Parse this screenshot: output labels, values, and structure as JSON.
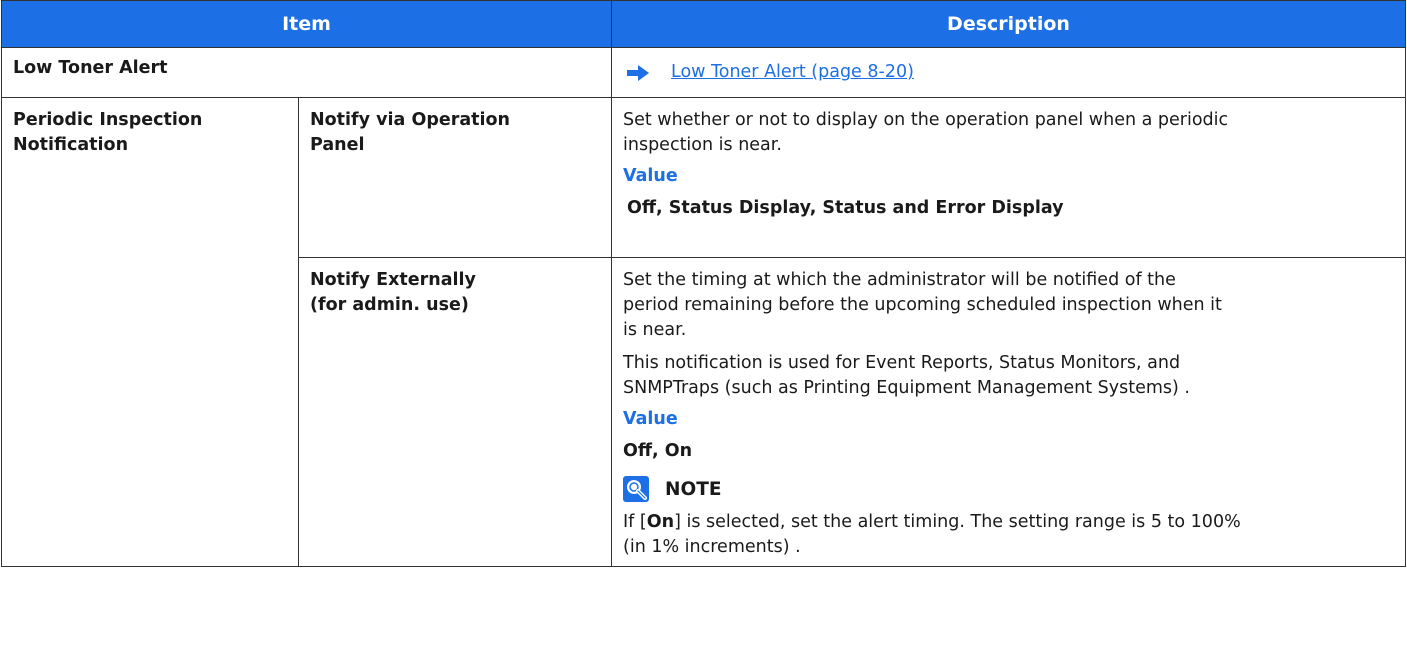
{
  "table": {
    "header": {
      "item": "Item",
      "description": "Description"
    },
    "low_toner": {
      "label": "Low Toner Alert",
      "link_text": "Low Toner Alert (page 8-20)"
    },
    "periodic": {
      "label_line1": "Periodic Inspection",
      "label_line2": "Notification",
      "panel": {
        "label_line1": "Notify via Operation",
        "label_line2": "Panel",
        "desc_line1": "Set whether or not to display on the operation panel when a periodic",
        "desc_line2": "inspection is near.",
        "value_label": "Value",
        "value_text": "Off, Status Display, Status and Error Display"
      },
      "external": {
        "label_line1": "Notify Externally",
        "label_line2": "(for admin. use)",
        "desc1_line1": "Set the timing at which the administrator will be notified of the",
        "desc1_line2": "period remaining before the upcoming scheduled inspection when it",
        "desc1_line3": "is near.",
        "desc2_line1": "This notification is used for Event Reports, Status Monitors, and",
        "desc2_line2": "SNMPTraps (such as Printing Equipment Management Systems) .",
        "value_label": "Value",
        "value_text": "Off, On",
        "note_title": "NOTE",
        "note_pre": "If [",
        "note_bold": "On",
        "note_post": "] is selected, set the alert timing. The setting range is 5 to 100%",
        "note_line2": "(in 1% increments) ."
      }
    }
  },
  "colors": {
    "header_bg": "#1c6fe4",
    "accent": "#1c6fe4",
    "border": "#333333"
  },
  "icons": {
    "link_arrow": "arrow-right-icon",
    "note": "note-lightbulb-icon"
  }
}
